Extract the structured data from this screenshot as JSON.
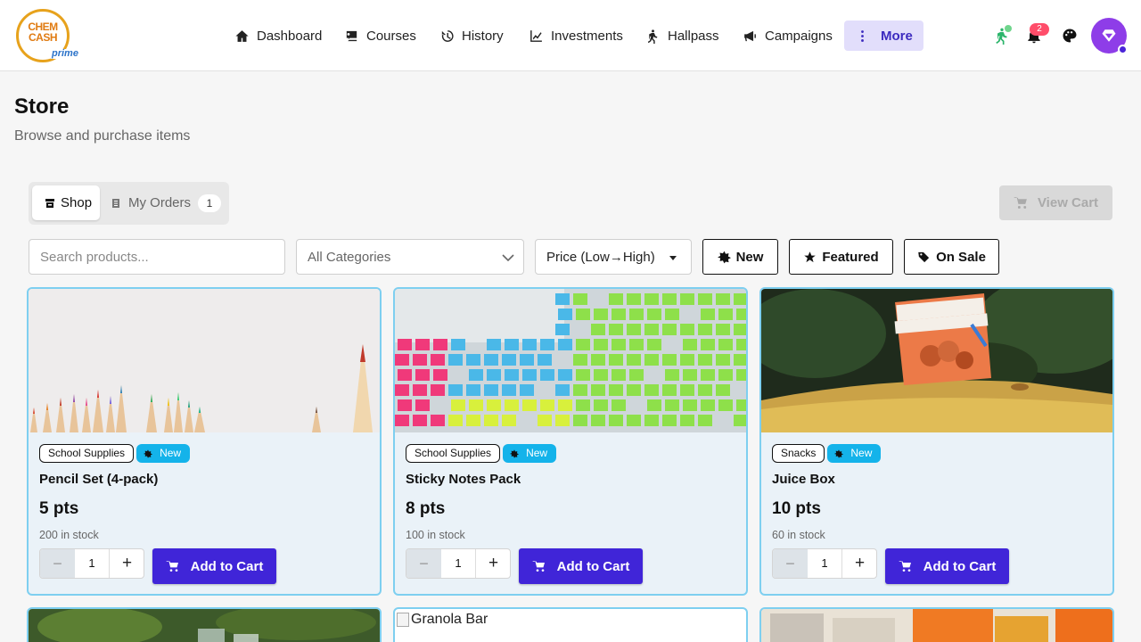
{
  "brand": {
    "logo_line1": "CHEM",
    "logo_line2": "CASH",
    "logo_sub": "prime"
  },
  "nav": [
    {
      "label": "Dashboard",
      "icon": "home-icon"
    },
    {
      "label": "Courses",
      "icon": "courses-icon"
    },
    {
      "label": "History",
      "icon": "history-icon"
    },
    {
      "label": "Investments",
      "icon": "investments-icon"
    },
    {
      "label": "Hallpass",
      "icon": "hallpass-icon"
    },
    {
      "label": "Campaigns",
      "icon": "megaphone-icon"
    },
    {
      "label": "More",
      "icon": "more-vertical-icon"
    }
  ],
  "header": {
    "notification_count": "2"
  },
  "page": {
    "title": "Store",
    "subtitle": "Browse and purchase items"
  },
  "tabs": {
    "shop": "Shop",
    "orders": "My Orders",
    "orders_count": "1"
  },
  "view_cart": "View Cart",
  "filters": {
    "search_placeholder": "Search products...",
    "category": "All Categories",
    "sort": "Price (Low→High)",
    "new": "New",
    "featured": "Featured",
    "on_sale": "On Sale"
  },
  "products": [
    {
      "name": "Pencil Set (4-pack)",
      "category": "School Supplies",
      "badge": "New",
      "price": "5 pts",
      "stock": "200 in stock",
      "qty": "1",
      "action": "Add to Cart"
    },
    {
      "name": "Sticky Notes Pack",
      "category": "School Supplies",
      "badge": "New",
      "price": "8 pts",
      "stock": "100 in stock",
      "qty": "1",
      "action": "Add to Cart"
    },
    {
      "name": "Juice Box",
      "category": "Snacks",
      "badge": "New",
      "price": "10 pts",
      "stock": "60 in stock",
      "qty": "1",
      "action": "Add to Cart"
    }
  ],
  "next_row": {
    "broken_image_alt": "Granola Bar"
  },
  "colors": {
    "accent": "#4025d8",
    "more_bg": "#e2defb",
    "card_border": "#7ecff0",
    "new_badge": "#14b3ea"
  }
}
